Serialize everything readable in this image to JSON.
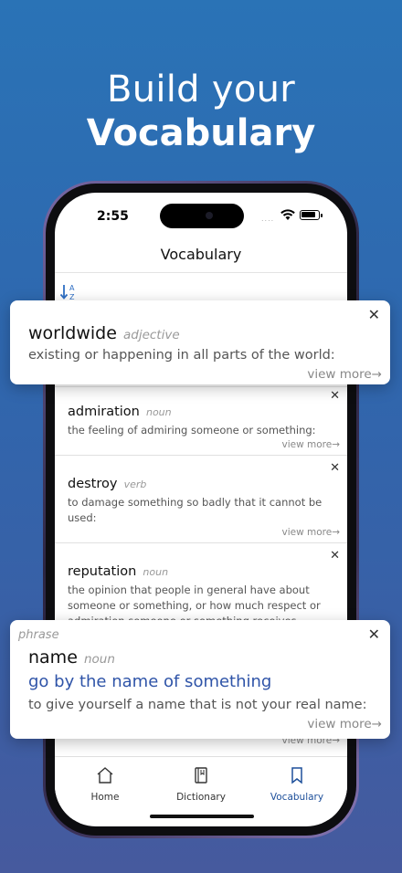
{
  "headline": {
    "line1": "Build your",
    "line2": "Vocabulary"
  },
  "status": {
    "time": "2:55",
    "signal": "...."
  },
  "nav": {
    "title": "Vocabulary"
  },
  "sort": {
    "label": "A Z"
  },
  "cards": [
    {
      "word": "admiration",
      "pos": "noun",
      "definition": "the feeling of admiring someone or something:",
      "more": "view more→"
    },
    {
      "word": "destroy",
      "pos": "verb",
      "definition": "to damage something so badly that it cannot be used:",
      "more": "view more→"
    },
    {
      "word": "reputation",
      "pos": "noun",
      "definition": "the opinion that people in general have about someone or something, or how much respect or admiration someone or something receives, based",
      "more": "view more→"
    }
  ],
  "float_top": {
    "word": "worldwide",
    "pos": "adjective",
    "definition": "existing or happening in all parts of the world:",
    "more": "view more→",
    "close": "✕"
  },
  "float_bottom": {
    "kind": "phrase",
    "word": "name",
    "pos": "noun",
    "phrase": "go by the name of something",
    "definition": "to give yourself a name that is not your real name:",
    "more": "view more→",
    "close": "✕",
    "accent": "#2f54a8"
  },
  "tabs": [
    {
      "label": "Home",
      "icon": "home-icon"
    },
    {
      "label": "Dictionary",
      "icon": "book-icon"
    },
    {
      "label": "Vocabulary",
      "icon": "bookmark-icon",
      "active": true
    }
  ],
  "colors": {
    "bg_top": "#2a73b6",
    "bg_bottom": "#465a9e",
    "active_tab": "#1d4f9a"
  }
}
